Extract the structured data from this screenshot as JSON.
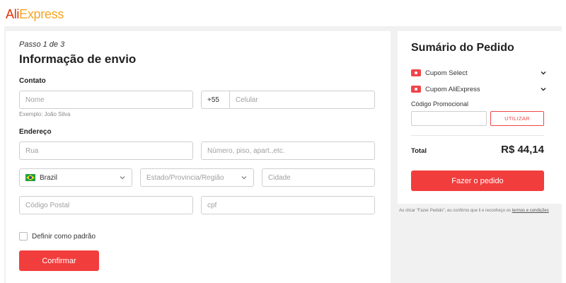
{
  "brand": {
    "logo_prefix": "Ali",
    "logo_suffix": "Express"
  },
  "shipping": {
    "step": "Passo 1 de 3",
    "title": "Informação de envio",
    "contact_label": "Contato",
    "name_placeholder": "Nome",
    "phone_prefix": "+55",
    "phone_placeholder": "Celular",
    "name_hint": "Exemplo: João Silva",
    "address_label": "Endereço",
    "street_placeholder": "Rua",
    "number_placeholder": "Número, piso, apart.,etc.",
    "country_value": "Brazil",
    "state_placeholder": "Estado/Provincia/Região",
    "city_placeholder": "Cidade",
    "postal_placeholder": "Código Postal",
    "cpf_placeholder": "cpf",
    "default_checkbox_label": "Definir como padrão",
    "default_checked": false,
    "confirm_label": "Confirmar"
  },
  "summary": {
    "title": "Sumário do Pedido",
    "coupons": [
      {
        "label": "Cupom Select",
        "icon": "coupon-icon"
      },
      {
        "label": "Cupom AliExpress",
        "icon": "coupon-icon"
      }
    ],
    "promo_label": "Código Promocional",
    "promo_value": "",
    "promo_button": "UTILIZAR",
    "total_label": "Total",
    "total_value": "R$ 44,14",
    "order_button": "Fazer o pedido",
    "disclaimer_text": "Ao clicar \"Fazer Pedido\", eu confirmo que li e reconheço os ",
    "disclaimer_link": "termos e condições"
  },
  "colors": {
    "accent": "#f23d3d",
    "logo_red": "#e62e04",
    "logo_orange": "#f5a623",
    "background": "#f1f1f1"
  }
}
